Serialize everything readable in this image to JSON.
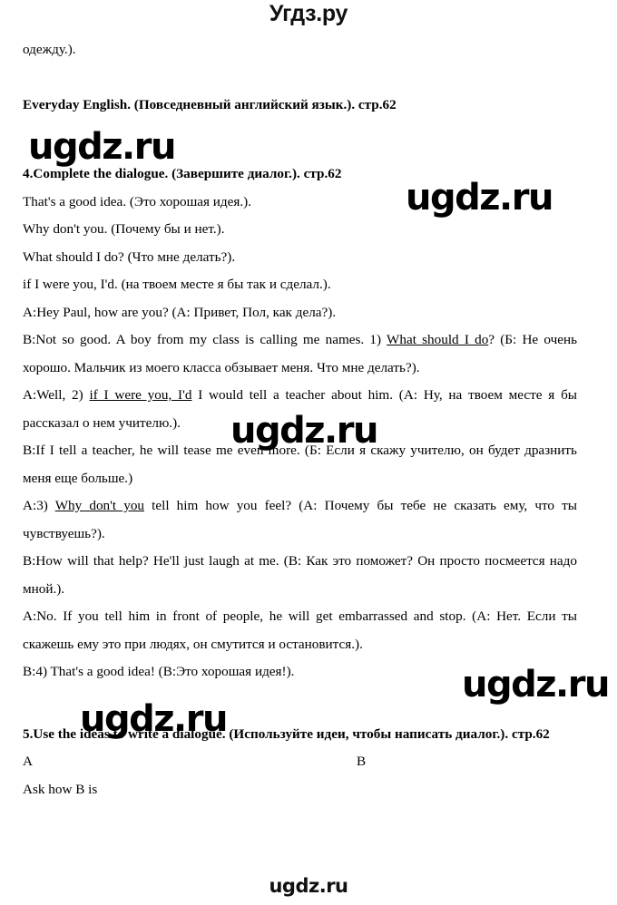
{
  "site": {
    "header_logo": "Угдз.ру",
    "footer_logo": "ugdz.ru",
    "watermark_text": "ugdz.ru"
  },
  "document": {
    "carryover_line": "одежду.).",
    "section_heading": "Everyday English. (Повседневный английский язык.). стр.62",
    "task4": {
      "heading": "4.Complete the dialogue. (Завершите диалог.). стр.62",
      "word_bank": [
        "That's a good idea. (Это хорошая идея.).",
        "Why don't you. (Почему бы и нет.).",
        "What should I do? (Что мне делать?).",
        "if I were you, I'd. (на твоем месте я бы так и сделал.)."
      ],
      "dialogue": [
        {
          "speaker": "A:",
          "before": "Hey Paul, how are you? (A: Привет, Пол, как дела?).",
          "answer": "",
          "after": ""
        },
        {
          "speaker": "B:",
          "before": "Not so good. A boy from my class is calling me names. 1) ",
          "answer": "What should I do",
          "after": "? (Б: Не очень хорошо. Мальчик из моего класса обзывает меня. Что мне делать?)."
        },
        {
          "speaker": "A:",
          "before": "Well, 2) ",
          "answer": "if I were you, I'd",
          "after": " I would tell a teacher about him. (A: Ну, на твоем месте я бы рассказал о нем учителю.)."
        },
        {
          "speaker": "B:",
          "before": "If I tell a teacher, he will tease me even more. (Б: Если я скажу учителю, он будет дразнить меня еще больше.)",
          "answer": "",
          "after": ""
        },
        {
          "speaker": "A:",
          "before": "3) ",
          "answer": "Why don't you",
          "after": " tell him how you feel? (A: Почему бы тебе не сказать ему, что ты чувствуешь?)."
        },
        {
          "speaker": "B:",
          "before": "How will that help? He'll just laugh at me. (B: Как это поможет? Он просто посмеется надо мной.).",
          "answer": "",
          "after": ""
        },
        {
          "speaker": "A:",
          "before": "No. If you tell him in front of people, he will get embarrassed and stop. (A: Нет. Если ты скажешь ему это при людях, он смутится и остановится.).",
          "answer": "",
          "after": ""
        },
        {
          "speaker": "B:",
          "before": "4) That's a good idea! (B:Это хорошая идея!).",
          "answer": "",
          "after": ""
        }
      ]
    },
    "task5": {
      "heading": "5.Use the ideas to write a dialogue. (Используйте идеи, чтобы написать диалог.). стр.62",
      "column_a_label": "A",
      "column_b_label": "B",
      "first_prompt": "Ask how B is"
    }
  }
}
